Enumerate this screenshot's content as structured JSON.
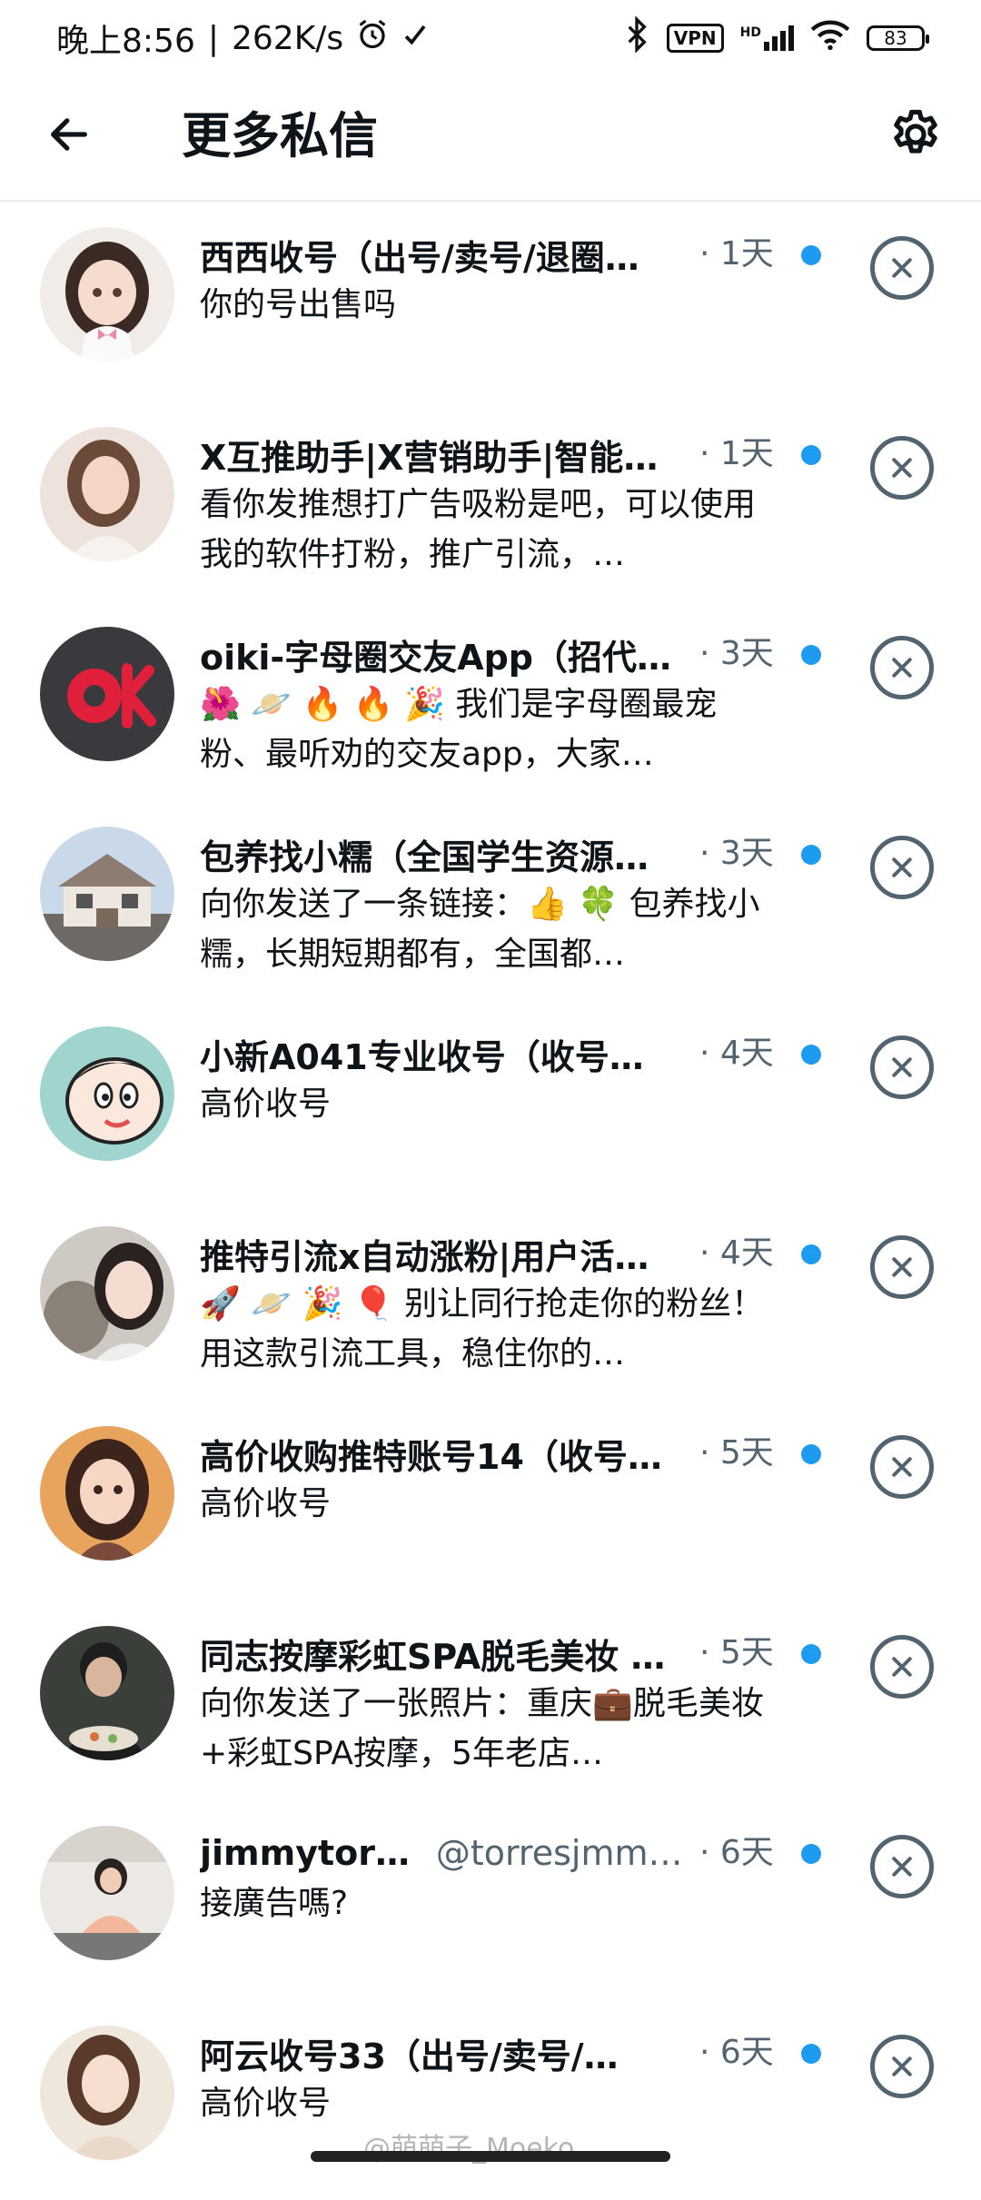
{
  "status_bar": {
    "time": "晚上8:56",
    "network_speed": "262K/s",
    "vpn": "VPN",
    "signal_prefix": "HD",
    "battery": "83"
  },
  "header": {
    "title": "更多私信",
    "back_icon": "back-arrow-icon",
    "settings_icon": "gear-icon"
  },
  "colors": {
    "unread_dot": "#1d9bf0",
    "secondary_text": "#536471",
    "primary_text": "#0f1419",
    "divider": "#e6ecf0"
  },
  "conversations": [
    {
      "name": "西西收号（出号/卖号/退圈…",
      "handle": "",
      "time": "· 1天",
      "message": "你的号出售吗",
      "unread": true,
      "avatar": "anime-girl-avatar"
    },
    {
      "name": "X互推助手|X营销助手|智能…",
      "handle": "",
      "time": "· 1天",
      "message": "看你发推想打广告吸粉是吧，可以使用我的软件打粉，推广引流，…",
      "unread": true,
      "avatar": "woman-photo-avatar"
    },
    {
      "name": "oiki-字母圈交友App（招代…",
      "handle": "",
      "time": "· 3天",
      "message": "🌺 🪐 🔥 🔥 🎉 我们是字母圈最宠粉、最听劝的交友app，大家…",
      "unread": true,
      "avatar": "oik-logo-avatar"
    },
    {
      "name": "包养找小糯（全国学生资源…",
      "handle": "",
      "time": "· 3天",
      "message": "向你发送了一条链接：👍 🍀 包养找小糯，长期短期都有，全国都…",
      "unread": true,
      "avatar": "house-photo-avatar"
    },
    {
      "name": "小新A041专业收号（收号…",
      "handle": "",
      "time": "· 4天",
      "message": "高价收号",
      "unread": true,
      "avatar": "cartoon-avatar"
    },
    {
      "name": "推特引流x自动涨粉|用户活…",
      "handle": "",
      "time": "· 4天",
      "message": "🚀 🪐 🎉 🎈 别让同行抢走你的粉丝！用这款引流工具，稳住你的…",
      "unread": true,
      "avatar": "girl-with-cat-avatar"
    },
    {
      "name": "高价收购推特账号14（收号…",
      "handle": "",
      "time": "· 5天",
      "message": "高价收号",
      "unread": true,
      "avatar": "anime-portrait-avatar"
    },
    {
      "name": "同志按摩彩虹SPA脱毛美妆 …",
      "handle": "",
      "time": "· 5天",
      "message": "向你发送了一张照片：重庆💼脱毛美妆+彩虹SPA按摩，5年老店…",
      "unread": true,
      "avatar": "man-photo-avatar"
    },
    {
      "name": "jimmytorres",
      "handle": "@torresjmmy…",
      "time": "· 6天",
      "message": "接廣告嗎?",
      "unread": true,
      "avatar": "woman-room-avatar"
    },
    {
      "name": "阿云收号33（出号/卖号/…",
      "handle": "",
      "time": "· 6天",
      "message": "高价收号",
      "unread": true,
      "avatar": "woman-portrait-avatar"
    }
  ],
  "watermark": "@萌萌子_Moeko"
}
